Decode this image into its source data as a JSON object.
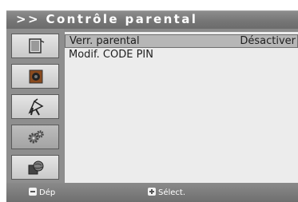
{
  "header": {
    "title": ">> Contrôle parental"
  },
  "sidebar": {
    "items": [
      {
        "icon": "tv-screen-icon"
      },
      {
        "icon": "speaker-icon"
      },
      {
        "icon": "satellite-antenna-icon"
      },
      {
        "icon": "gears-icon",
        "active": true
      },
      {
        "icon": "globe-icon"
      }
    ]
  },
  "menu": {
    "items": [
      {
        "label": "Verr. parental",
        "value": "Désactiver",
        "selected": true
      },
      {
        "label": "Modif. CODE PIN",
        "value": ""
      }
    ]
  },
  "footer": {
    "hint_move": "Dép",
    "hint_select": "Sélect."
  },
  "colors": {
    "selection": "#b6b6b6",
    "bar": "#7a7a7a",
    "panel": "#ececec"
  }
}
